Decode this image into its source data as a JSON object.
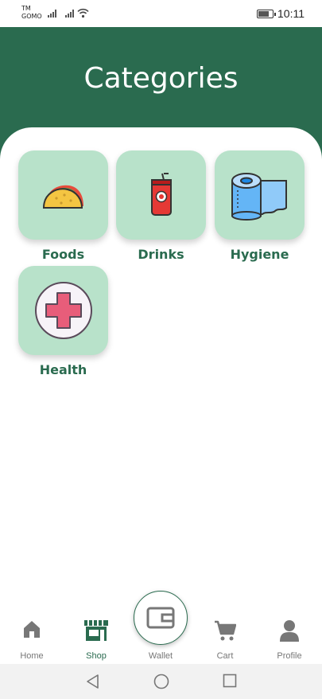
{
  "status_bar": {
    "carrier_line1": "TM",
    "carrier_line2": "GOMO",
    "time": "10:11",
    "icons": [
      "signal-icon",
      "signal-icon",
      "wifi-icon",
      "battery-icon"
    ]
  },
  "header": {
    "title": "Categories"
  },
  "categories": [
    {
      "label": "Foods",
      "icon": "taco-icon"
    },
    {
      "label": "Drinks",
      "icon": "soda-can-icon"
    },
    {
      "label": "Hygiene",
      "icon": "toilet-paper-icon"
    },
    {
      "label": "Health",
      "icon": "medical-cross-icon"
    }
  ],
  "bottom_nav": {
    "items": [
      {
        "label": "Home",
        "icon": "home-icon",
        "active": false
      },
      {
        "label": "Shop",
        "icon": "shop-icon",
        "active": true
      },
      {
        "label": "Wallet",
        "icon": "wallet-icon",
        "active": false
      },
      {
        "label": "Cart",
        "icon": "cart-icon",
        "active": false
      },
      {
        "label": "Profile",
        "icon": "profile-icon",
        "active": false
      }
    ]
  },
  "system_nav": {
    "icons": [
      "back-icon",
      "home-circle-icon",
      "recents-icon"
    ]
  },
  "colors": {
    "primary": "#2a6b4f",
    "card_bg": "#b8e2ca",
    "inactive": "#777777"
  }
}
